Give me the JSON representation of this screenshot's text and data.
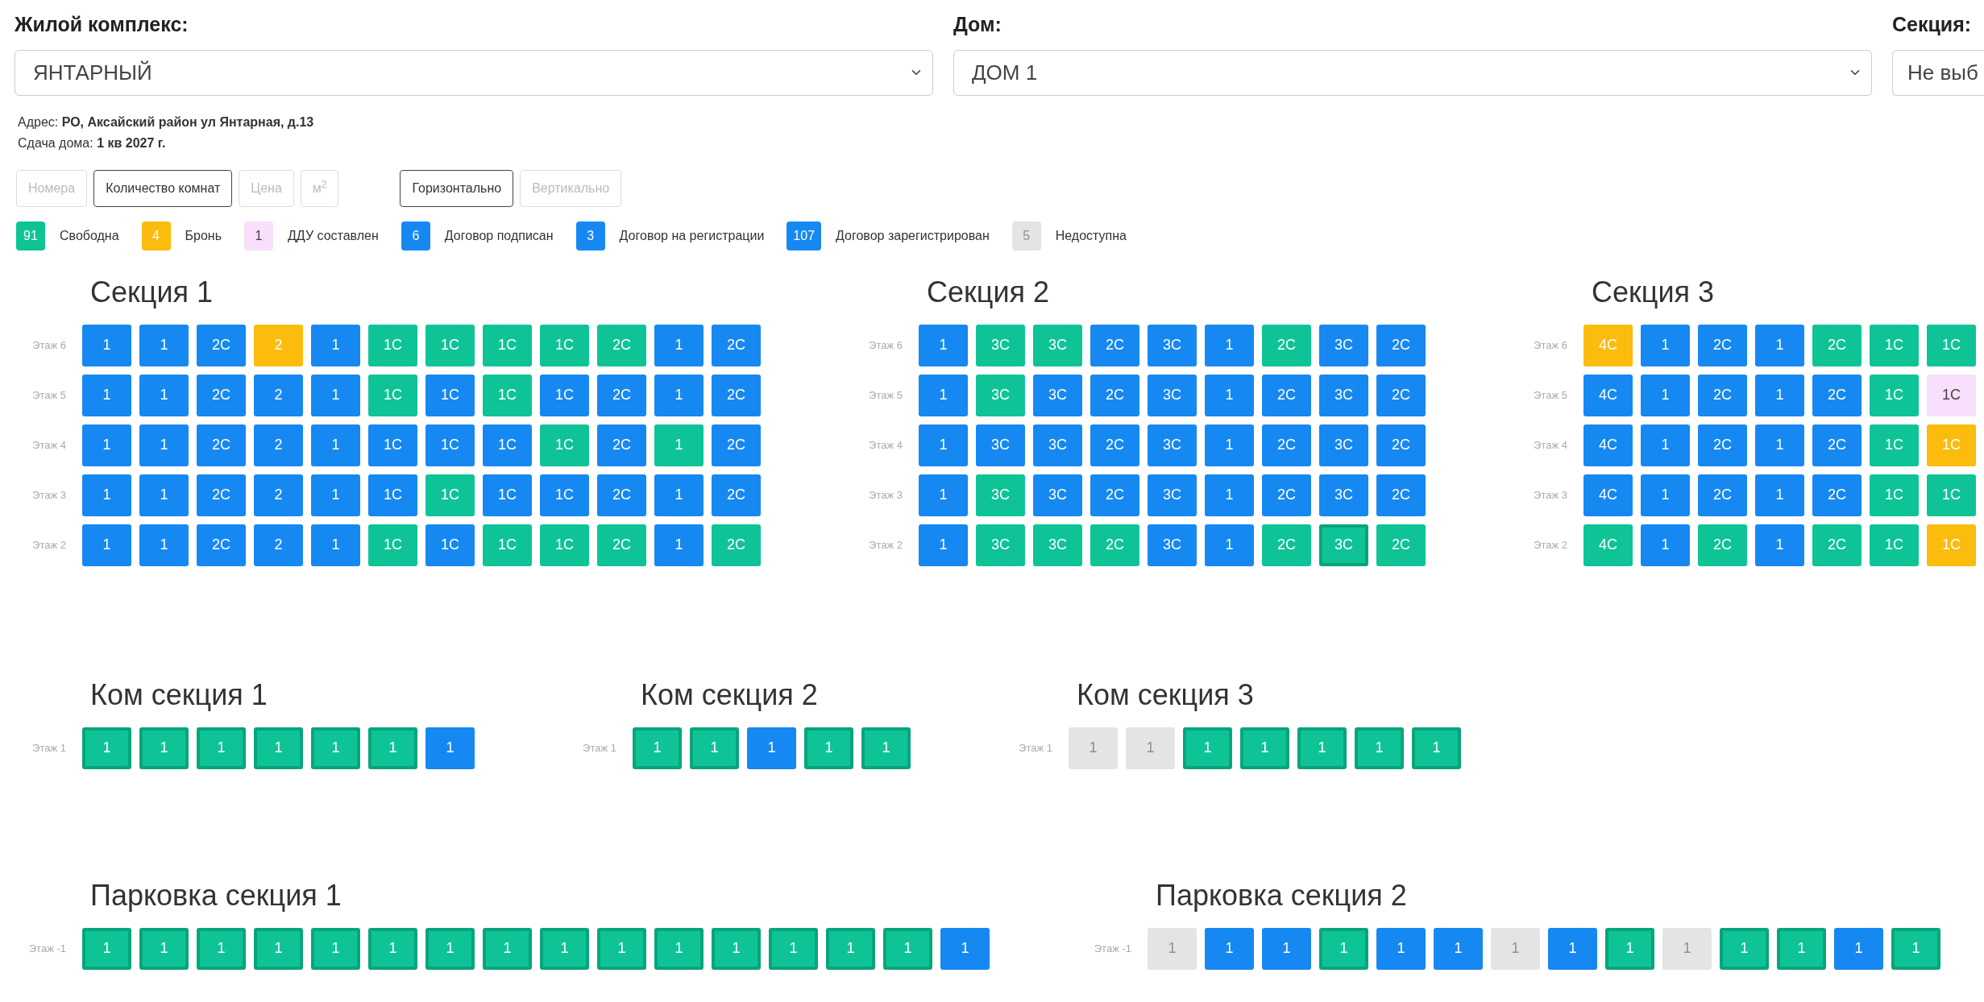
{
  "filters": [
    {
      "label": "Жилой комплекс:",
      "value": "ЯНТАРНЫЙ"
    },
    {
      "label": "Дом:",
      "value": "ДОМ 1"
    },
    {
      "label": "Секция:",
      "value": "Не выб"
    }
  ],
  "info": [
    "Адрес: **РО, Аксайский район ул Янтарная, д.13**",
    "Сдача дома: **1 кв 2027 г.**"
  ],
  "sort_buttons": [
    {
      "label": "Номера",
      "selected": false
    },
    {
      "label": "Количество комнат",
      "selected": true
    },
    {
      "label": "Цена",
      "selected": false
    },
    {
      "label": "м$^{2}$",
      "selected": false
    }
  ],
  "orientation_buttons": [
    {
      "label": "Горизонтально",
      "selected": true
    },
    {
      "label": "Вертикально",
      "selected": false
    }
  ],
  "legend": [
    {
      "count": "91",
      "label": "Свободна",
      "kind": "free"
    },
    {
      "count": "4",
      "label": "Бронь",
      "kind": "booked"
    },
    {
      "count": "1",
      "label": "ДДУ составлен",
      "kind": "ddu"
    },
    {
      "count": "6",
      "label": "Договор подписан",
      "kind": "sold"
    },
    {
      "count": "3",
      "label": "Договор на регистрации",
      "kind": "sold"
    },
    {
      "count": "107",
      "label": "Договор зарегистрирован",
      "kind": "sold"
    },
    {
      "count": "5",
      "label": "Недоступна",
      "kind": "na"
    }
  ],
  "section_rows": [
    [
      {
        "title": "Секция 1",
        "floors": [
          {
            "label": "Этаж 6",
            "cells": [
              {
                "label": "1",
                "kind": "sold",
                "outlined": false
              },
              {
                "label": "1",
                "kind": "sold",
                "outlined": false
              },
              {
                "label": "2С",
                "kind": "sold",
                "outlined": false
              },
              {
                "label": "2",
                "kind": "booked",
                "outlined": false
              },
              {
                "label": "1",
                "kind": "sold",
                "outlined": false
              },
              {
                "label": "1С",
                "kind": "free",
                "outlined": false
              },
              {
                "label": "1С",
                "kind": "free",
                "outlined": false
              },
              {
                "label": "1С",
                "kind": "free",
                "outlined": false
              },
              {
                "label": "1С",
                "kind": "free",
                "outlined": false
              },
              {
                "label": "2С",
                "kind": "free",
                "outlined": false
              },
              {
                "label": "1",
                "kind": "sold",
                "outlined": false
              },
              {
                "label": "2С",
                "kind": "sold",
                "outlined": false
              }
            ]
          },
          {
            "label": "Этаж 5",
            "cells": [
              {
                "label": "1",
                "kind": "sold",
                "outlined": false
              },
              {
                "label": "1",
                "kind": "sold",
                "outlined": false
              },
              {
                "label": "2С",
                "kind": "sold",
                "outlined": false
              },
              {
                "label": "2",
                "kind": "sold",
                "outlined": false
              },
              {
                "label": "1",
                "kind": "sold",
                "outlined": false
              },
              {
                "label": "1С",
                "kind": "free",
                "outlined": false
              },
              {
                "label": "1С",
                "kind": "sold",
                "outlined": false
              },
              {
                "label": "1С",
                "kind": "free",
                "outlined": false
              },
              {
                "label": "1С",
                "kind": "sold",
                "outlined": false
              },
              {
                "label": "2С",
                "kind": "sold",
                "outlined": false
              },
              {
                "label": "1",
                "kind": "sold",
                "outlined": false
              },
              {
                "label": "2С",
                "kind": "sold",
                "outlined": false
              }
            ]
          },
          {
            "label": "Этаж 4",
            "cells": [
              {
                "label": "1",
                "kind": "sold",
                "outlined": false
              },
              {
                "label": "1",
                "kind": "sold",
                "outlined": false
              },
              {
                "label": "2С",
                "kind": "sold",
                "outlined": false
              },
              {
                "label": "2",
                "kind": "sold",
                "outlined": false
              },
              {
                "label": "1",
                "kind": "sold",
                "outlined": false
              },
              {
                "label": "1С",
                "kind": "sold",
                "outlined": false
              },
              {
                "label": "1С",
                "kind": "sold",
                "outlined": false
              },
              {
                "label": "1С",
                "kind": "sold",
                "outlined": false
              },
              {
                "label": "1С",
                "kind": "free",
                "outlined": false
              },
              {
                "label": "2С",
                "kind": "sold",
                "outlined": false
              },
              {
                "label": "1",
                "kind": "free",
                "outlined": false
              },
              {
                "label": "2С",
                "kind": "sold",
                "outlined": false
              }
            ]
          },
          {
            "label": "Этаж 3",
            "cells": [
              {
                "label": "1",
                "kind": "sold",
                "outlined": false
              },
              {
                "label": "1",
                "kind": "sold",
                "outlined": false
              },
              {
                "label": "2С",
                "kind": "sold",
                "outlined": false
              },
              {
                "label": "2",
                "kind": "sold",
                "outlined": false
              },
              {
                "label": "1",
                "kind": "sold",
                "outlined": false
              },
              {
                "label": "1С",
                "kind": "sold",
                "outlined": false
              },
              {
                "label": "1С",
                "kind": "free",
                "outlined": false
              },
              {
                "label": "1С",
                "kind": "sold",
                "outlined": false
              },
              {
                "label": "1С",
                "kind": "sold",
                "outlined": false
              },
              {
                "label": "2С",
                "kind": "sold",
                "outlined": false
              },
              {
                "label": "1",
                "kind": "sold",
                "outlined": false
              },
              {
                "label": "2С",
                "kind": "sold",
                "outlined": false
              }
            ]
          },
          {
            "label": "Этаж 2",
            "cells": [
              {
                "label": "1",
                "kind": "sold",
                "outlined": false
              },
              {
                "label": "1",
                "kind": "sold",
                "outlined": false
              },
              {
                "label": "2С",
                "kind": "sold",
                "outlined": false
              },
              {
                "label": "2",
                "kind": "sold",
                "outlined": false
              },
              {
                "label": "1",
                "kind": "sold",
                "outlined": false
              },
              {
                "label": "1С",
                "kind": "free",
                "outlined": false
              },
              {
                "label": "1С",
                "kind": "sold",
                "outlined": false
              },
              {
                "label": "1С",
                "kind": "free",
                "outlined": false
              },
              {
                "label": "1С",
                "kind": "free",
                "outlined": false
              },
              {
                "label": "2С",
                "kind": "free",
                "outlined": false
              },
              {
                "label": "1",
                "kind": "sold",
                "outlined": false
              },
              {
                "label": "2С",
                "kind": "free",
                "outlined": false
              }
            ]
          }
        ]
      },
      {
        "title": "Секция 2",
        "floors": [
          {
            "label": "Этаж 6",
            "cells": [
              {
                "label": "1",
                "kind": "sold",
                "outlined": false
              },
              {
                "label": "3С",
                "kind": "free",
                "outlined": false
              },
              {
                "label": "3С",
                "kind": "free",
                "outlined": false
              },
              {
                "label": "2С",
                "kind": "sold",
                "outlined": false
              },
              {
                "label": "3С",
                "kind": "sold",
                "outlined": false
              },
              {
                "label": "1",
                "kind": "sold",
                "outlined": false
              },
              {
                "label": "2С",
                "kind": "free",
                "outlined": false
              },
              {
                "label": "3С",
                "kind": "sold",
                "outlined": false
              },
              {
                "label": "2С",
                "kind": "sold",
                "outlined": false
              }
            ]
          },
          {
            "label": "Этаж 5",
            "cells": [
              {
                "label": "1",
                "kind": "sold",
                "outlined": false
              },
              {
                "label": "3С",
                "kind": "free",
                "outlined": false
              },
              {
                "label": "3С",
                "kind": "sold",
                "outlined": false
              },
              {
                "label": "2С",
                "kind": "sold",
                "outlined": false
              },
              {
                "label": "3С",
                "kind": "sold",
                "outlined": false
              },
              {
                "label": "1",
                "kind": "sold",
                "outlined": false
              },
              {
                "label": "2С",
                "kind": "sold",
                "outlined": false
              },
              {
                "label": "3С",
                "kind": "sold",
                "outlined": false
              },
              {
                "label": "2С",
                "kind": "sold",
                "outlined": false
              }
            ]
          },
          {
            "label": "Этаж 4",
            "cells": [
              {
                "label": "1",
                "kind": "sold",
                "outlined": false
              },
              {
                "label": "3С",
                "kind": "sold",
                "outlined": false
              },
              {
                "label": "3С",
                "kind": "sold",
                "outlined": false
              },
              {
                "label": "2С",
                "kind": "sold",
                "outlined": false
              },
              {
                "label": "3С",
                "kind": "sold",
                "outlined": false
              },
              {
                "label": "1",
                "kind": "sold",
                "outlined": false
              },
              {
                "label": "2С",
                "kind": "sold",
                "outlined": false
              },
              {
                "label": "3С",
                "kind": "sold",
                "outlined": false
              },
              {
                "label": "2С",
                "kind": "sold",
                "outlined": false
              }
            ]
          },
          {
            "label": "Этаж 3",
            "cells": [
              {
                "label": "1",
                "kind": "sold",
                "outlined": false
              },
              {
                "label": "3С",
                "kind": "free",
                "outlined": false
              },
              {
                "label": "3С",
                "kind": "sold",
                "outlined": false
              },
              {
                "label": "2С",
                "kind": "sold",
                "outlined": false
              },
              {
                "label": "3С",
                "kind": "sold",
                "outlined": false
              },
              {
                "label": "1",
                "kind": "sold",
                "outlined": false
              },
              {
                "label": "2С",
                "kind": "sold",
                "outlined": false
              },
              {
                "label": "3С",
                "kind": "sold",
                "outlined": false
              },
              {
                "label": "2С",
                "kind": "sold",
                "outlined": false
              }
            ]
          },
          {
            "label": "Этаж 2",
            "cells": [
              {
                "label": "1",
                "kind": "sold",
                "outlined": false
              },
              {
                "label": "3С",
                "kind": "free",
                "outlined": false
              },
              {
                "label": "3С",
                "kind": "free",
                "outlined": false
              },
              {
                "label": "2С",
                "kind": "free",
                "outlined": false
              },
              {
                "label": "3С",
                "kind": "sold",
                "outlined": false
              },
              {
                "label": "1",
                "kind": "sold",
                "outlined": false
              },
              {
                "label": "2С",
                "kind": "free",
                "outlined": false
              },
              {
                "label": "3С",
                "kind": "free",
                "outlined": true
              },
              {
                "label": "2С",
                "kind": "free",
                "outlined": false
              }
            ]
          }
        ]
      },
      {
        "title": "Секция 3",
        "floors": [
          {
            "label": "Этаж 6",
            "cells": [
              {
                "label": "4С",
                "kind": "booked",
                "outlined": false
              },
              {
                "label": "1",
                "kind": "sold",
                "outlined": false
              },
              {
                "label": "2С",
                "kind": "sold",
                "outlined": false
              },
              {
                "label": "1",
                "kind": "sold",
                "outlined": false
              },
              {
                "label": "2С",
                "kind": "free",
                "outlined": false
              },
              {
                "label": "1С",
                "kind": "free",
                "outlined": false
              },
              {
                "label": "1С",
                "kind": "free",
                "outlined": false
              }
            ]
          },
          {
            "label": "Этаж 5",
            "cells": [
              {
                "label": "4С",
                "kind": "sold",
                "outlined": false
              },
              {
                "label": "1",
                "kind": "sold",
                "outlined": false
              },
              {
                "label": "2С",
                "kind": "sold",
                "outlined": false
              },
              {
                "label": "1",
                "kind": "sold",
                "outlined": false
              },
              {
                "label": "2С",
                "kind": "sold",
                "outlined": false
              },
              {
                "label": "1С",
                "kind": "free",
                "outlined": false
              },
              {
                "label": "1С",
                "kind": "ddu",
                "outlined": false
              }
            ]
          },
          {
            "label": "Этаж 4",
            "cells": [
              {
                "label": "4С",
                "kind": "sold",
                "outlined": false
              },
              {
                "label": "1",
                "kind": "sold",
                "outlined": false
              },
              {
                "label": "2С",
                "kind": "sold",
                "outlined": false
              },
              {
                "label": "1",
                "kind": "sold",
                "outlined": false
              },
              {
                "label": "2С",
                "kind": "sold",
                "outlined": false
              },
              {
                "label": "1С",
                "kind": "free",
                "outlined": false
              },
              {
                "label": "1С",
                "kind": "booked",
                "outlined": false
              }
            ]
          },
          {
            "label": "Этаж 3",
            "cells": [
              {
                "label": "4С",
                "kind": "sold",
                "outlined": false
              },
              {
                "label": "1",
                "kind": "sold",
                "outlined": false
              },
              {
                "label": "2С",
                "kind": "sold",
                "outlined": false
              },
              {
                "label": "1",
                "kind": "sold",
                "outlined": false
              },
              {
                "label": "2С",
                "kind": "sold",
                "outlined": false
              },
              {
                "label": "1С",
                "kind": "free",
                "outlined": false
              },
              {
                "label": "1С",
                "kind": "free",
                "outlined": false
              }
            ]
          },
          {
            "label": "Этаж 2",
            "cells": [
              {
                "label": "4С",
                "kind": "free",
                "outlined": false
              },
              {
                "label": "1",
                "kind": "sold",
                "outlined": false
              },
              {
                "label": "2С",
                "kind": "free",
                "outlined": false
              },
              {
                "label": "1",
                "kind": "sold",
                "outlined": false
              },
              {
                "label": "2С",
                "kind": "free",
                "outlined": false
              },
              {
                "label": "1С",
                "kind": "free",
                "outlined": false
              },
              {
                "label": "1С",
                "kind": "booked",
                "outlined": false
              }
            ]
          }
        ]
      }
    ],
    [
      {
        "title": "Ком секция 1",
        "floors": [
          {
            "label": "Этаж 1",
            "cells": [
              {
                "label": "1",
                "kind": "free",
                "outlined": true
              },
              {
                "label": "1",
                "kind": "free",
                "outlined": true
              },
              {
                "label": "1",
                "kind": "free",
                "outlined": true
              },
              {
                "label": "1",
                "kind": "free",
                "outlined": true
              },
              {
                "label": "1",
                "kind": "free",
                "outlined": true
              },
              {
                "label": "1",
                "kind": "free",
                "outlined": true
              },
              {
                "label": "1",
                "kind": "sold",
                "outlined": false
              }
            ]
          }
        ]
      },
      {
        "title": "Ком секция 2",
        "floors": [
          {
            "label": "Этаж 1",
            "cells": [
              {
                "label": "1",
                "kind": "free",
                "outlined": true
              },
              {
                "label": "1",
                "kind": "free",
                "outlined": true
              },
              {
                "label": "1",
                "kind": "sold",
                "outlined": false
              },
              {
                "label": "1",
                "kind": "free",
                "outlined": true
              },
              {
                "label": "1",
                "kind": "free",
                "outlined": true
              }
            ]
          }
        ]
      },
      {
        "title": "Ком секция 3",
        "floors": [
          {
            "label": "Этаж 1",
            "cells": [
              {
                "label": "1",
                "kind": "na",
                "outlined": false
              },
              {
                "label": "1",
                "kind": "na",
                "outlined": false
              },
              {
                "label": "1",
                "kind": "free",
                "outlined": true
              },
              {
                "label": "1",
                "kind": "free",
                "outlined": true
              },
              {
                "label": "1",
                "kind": "free",
                "outlined": true
              },
              {
                "label": "1",
                "kind": "free",
                "outlined": true
              },
              {
                "label": "1",
                "kind": "free",
                "outlined": true
              }
            ]
          }
        ]
      }
    ],
    [
      {
        "title": "Парковка секция 1",
        "floors": [
          {
            "label": "Этаж -1",
            "cells": [
              {
                "label": "1",
                "kind": "free",
                "outlined": true
              },
              {
                "label": "1",
                "kind": "free",
                "outlined": true
              },
              {
                "label": "1",
                "kind": "free",
                "outlined": true
              },
              {
                "label": "1",
                "kind": "free",
                "outlined": true
              },
              {
                "label": "1",
                "kind": "free",
                "outlined": true
              },
              {
                "label": "1",
                "kind": "free",
                "outlined": true
              },
              {
                "label": "1",
                "kind": "free",
                "outlined": true
              },
              {
                "label": "1",
                "kind": "free",
                "outlined": true
              },
              {
                "label": "1",
                "kind": "free",
                "outlined": true
              },
              {
                "label": "1",
                "kind": "free",
                "outlined": true
              },
              {
                "label": "1",
                "kind": "free",
                "outlined": true
              },
              {
                "label": "1",
                "kind": "free",
                "outlined": true
              },
              {
                "label": "1",
                "kind": "free",
                "outlined": true
              },
              {
                "label": "1",
                "kind": "free",
                "outlined": true
              },
              {
                "label": "1",
                "kind": "free",
                "outlined": true
              },
              {
                "label": "1",
                "kind": "sold",
                "outlined": false
              }
            ]
          }
        ]
      },
      {
        "title": "Парковка секция 2",
        "floors": [
          {
            "label": "Этаж -1",
            "cells": [
              {
                "label": "1",
                "kind": "na",
                "outlined": false
              },
              {
                "label": "1",
                "kind": "sold",
                "outlined": false
              },
              {
                "label": "1",
                "kind": "sold",
                "outlined": false
              },
              {
                "label": "1",
                "kind": "free",
                "outlined": true
              },
              {
                "label": "1",
                "kind": "sold",
                "outlined": false
              },
              {
                "label": "1",
                "kind": "sold",
                "outlined": false
              },
              {
                "label": "1",
                "kind": "na",
                "outlined": false
              },
              {
                "label": "1",
                "kind": "sold",
                "outlined": false
              },
              {
                "label": "1",
                "kind": "free",
                "outlined": true
              },
              {
                "label": "1",
                "kind": "na",
                "outlined": false
              },
              {
                "label": "1",
                "kind": "free",
                "outlined": true
              },
              {
                "label": "1",
                "kind": "free",
                "outlined": true
              },
              {
                "label": "1",
                "kind": "sold",
                "outlined": false
              },
              {
                "label": "1",
                "kind": "free",
                "outlined": true
              }
            ]
          }
        ]
      }
    ]
  ]
}
